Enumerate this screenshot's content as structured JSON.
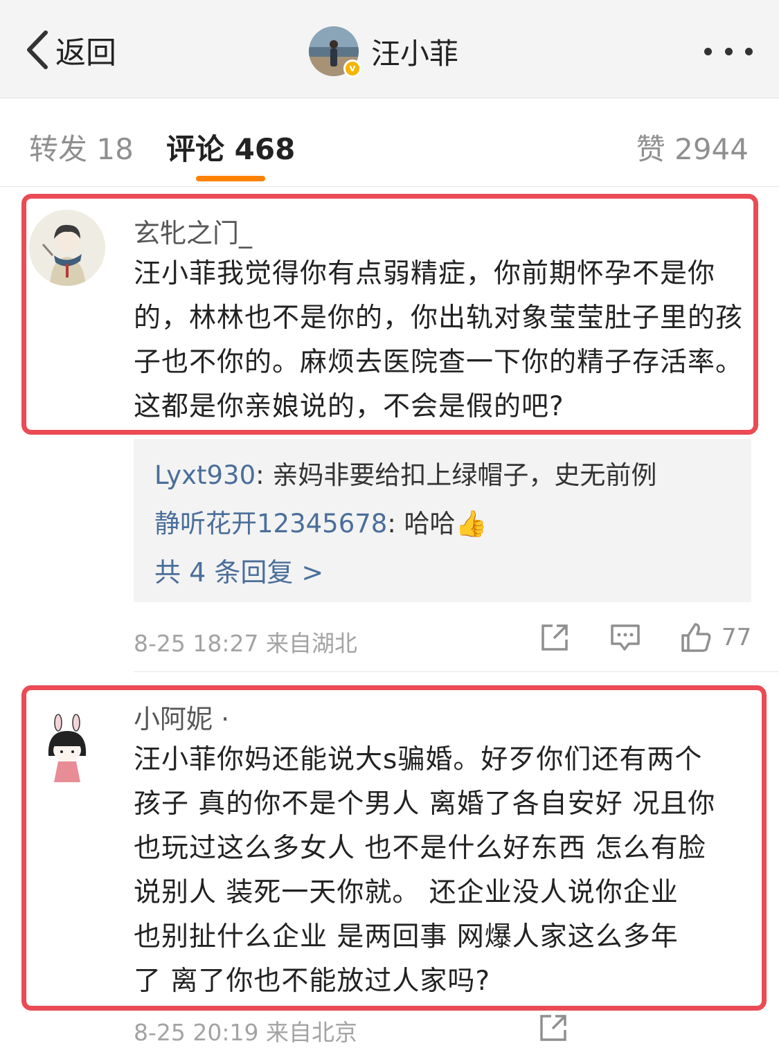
{
  "nav": {
    "back_label": "返回",
    "author_name": "汪小菲",
    "verified_badge": "v"
  },
  "tabs": {
    "repost": "转发 18",
    "comments": "评论 468",
    "likes": "赞 2944"
  },
  "comments": [
    {
      "user": "玄牝之门_",
      "text": "汪小菲我觉得你有点弱精症，你前期怀孕不是你的，林林也不是你的，你出轨对象莹莹肚子里的孩子也不你的。麻烦去医院查一下你的精子存活率。这都是你亲娘说的，不会是假的吧?",
      "replies": [
        {
          "user": "Lyxt930",
          "text": ": 亲妈非要给扣上绿帽子，史无前例"
        },
        {
          "user": "静听花开12345678",
          "text": ": 哈哈👍"
        }
      ],
      "more_replies": "共 4 条回复 >",
      "time_location": "8-25 18:27  来自湖北",
      "like_count": "77"
    },
    {
      "user": "小阿妮 ·",
      "lines": [
        "汪小菲你妈还能说大s骗婚。好歹你们还有两个",
        "孩子 真的你不是个男人 离婚了各自安好 况且你",
        "也玩过这么多女人 也不是什么好东西 怎么有脸",
        "说别人 装死一天你就。  还企业没人说你企业",
        "也别扯什么企业 是两回事   网爆人家这么多年",
        "了 离了你也不能放过人家吗?"
      ],
      "time_location": "8-25 20:19  来自北京"
    }
  ],
  "colors": {
    "accent_orange": "#ff8200",
    "highlight_red": "#ea4b55",
    "link_blue": "#4a6e9a"
  }
}
